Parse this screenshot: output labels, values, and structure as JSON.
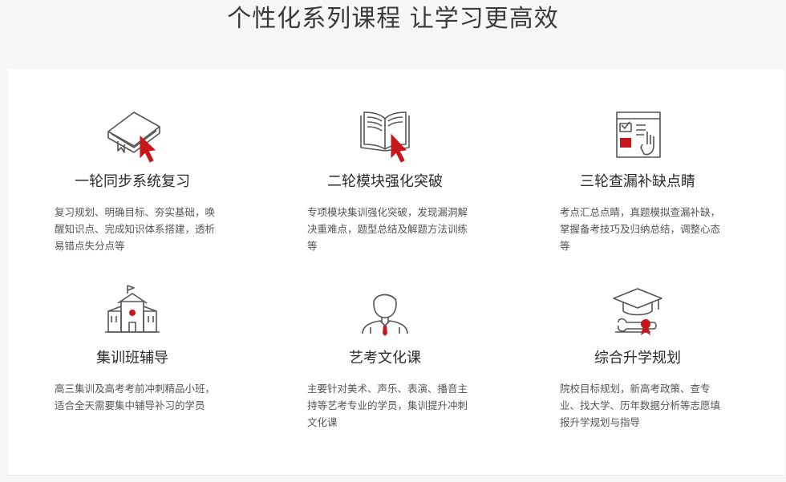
{
  "page": {
    "title": "个性化系列课程 让学习更高效"
  },
  "cards": [
    {
      "title": "一轮同步系统复习",
      "desc": "复习规划、明确目标、夯实基础，唤醒知识点、完成知识体系搭建，透析易错点失分点等",
      "icon": "book-cursor-icon"
    },
    {
      "title": "二轮模块强化突破",
      "desc": "专项模块集训强化突破，发现漏洞解决重难点，题型总结及解题方法训练等",
      "icon": "open-book-cursor-icon"
    },
    {
      "title": "三轮查漏补缺点睛",
      "desc": "考点汇总点睛，真题模拟查漏补缺，掌握备考技巧及归纳总结，调整心态等",
      "icon": "checklist-hand-icon"
    },
    {
      "title": "集训班辅导",
      "desc": "高三集训及高考考前冲刺精品小班，适合全天需要集中辅导补习的学员",
      "icon": "school-building-icon"
    },
    {
      "title": "艺考文化课",
      "desc": "主要针对美术、声乐、表演、播音主持等艺考专业的学员，集训提升冲刺文化课",
      "icon": "student-avatar-icon"
    },
    {
      "title": "综合升学规划",
      "desc": "院校目标规划，新高考政策、查专业、找大学、历年数据分析等志愿填报升学规划与指导",
      "icon": "graduation-cap-diploma-icon"
    }
  ],
  "colors": {
    "accent": "#c8161d",
    "line": "#555555"
  }
}
